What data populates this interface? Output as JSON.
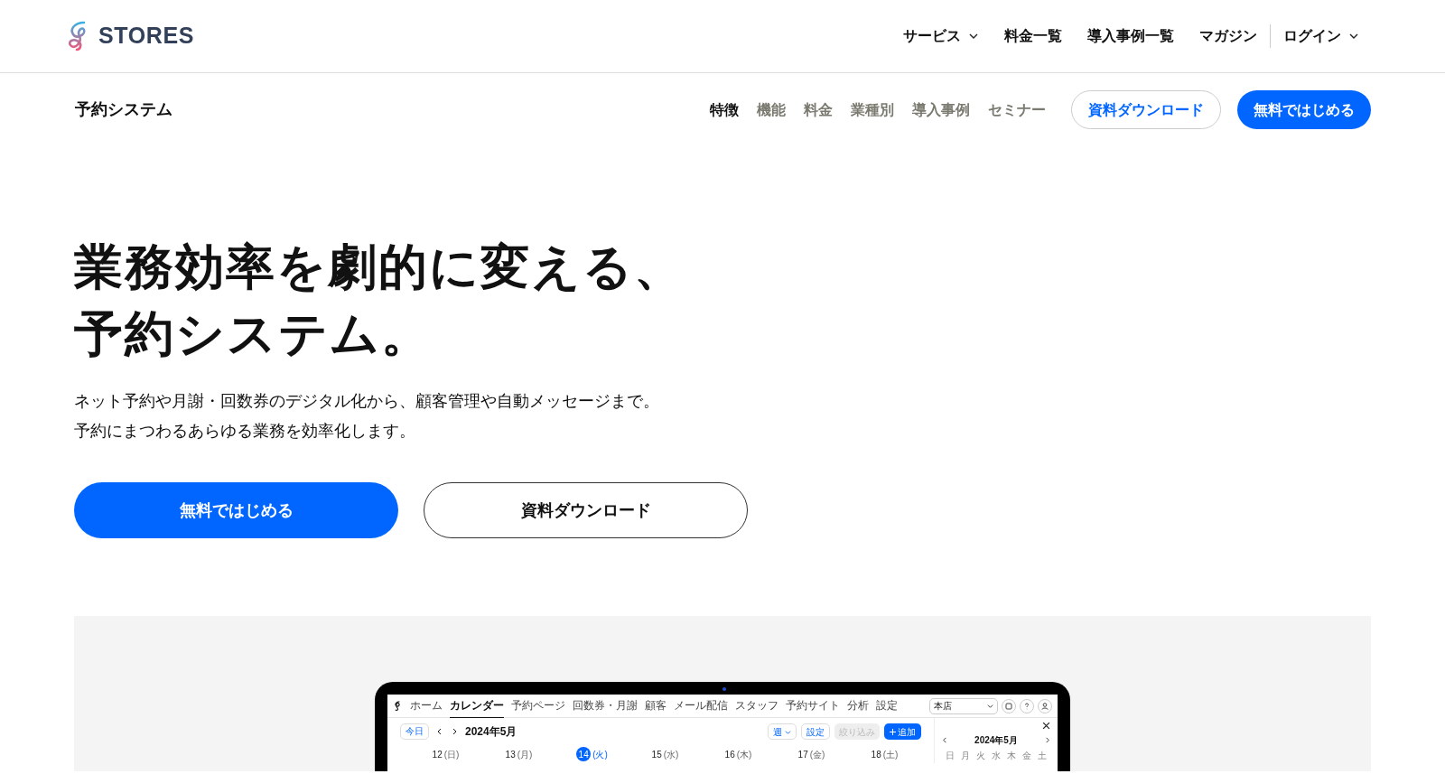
{
  "header": {
    "logo": "STORES",
    "nav": [
      {
        "label": "サービス",
        "dropdown": true
      },
      {
        "label": "料金一覧",
        "dropdown": false
      },
      {
        "label": "導入事例一覧",
        "dropdown": false
      },
      {
        "label": "マガジン",
        "dropdown": false
      }
    ],
    "login": {
      "label": "ログイン",
      "dropdown": true
    }
  },
  "subnav": {
    "title": "予約システム",
    "links": [
      {
        "label": "特徴",
        "selected": true
      },
      {
        "label": "機能",
        "selected": false
      },
      {
        "label": "料金",
        "selected": false
      },
      {
        "label": "業種別",
        "selected": false
      },
      {
        "label": "導入事例",
        "selected": false
      },
      {
        "label": "セミナー",
        "selected": false
      }
    ],
    "buttons": [
      {
        "label": "資料ダウンロード",
        "kind": "outline"
      },
      {
        "label": "無料ではじめる",
        "kind": "primary"
      }
    ]
  },
  "hero": {
    "title_lines": [
      "業務効率を劇的に変える、",
      "予約システム。"
    ],
    "description_lines": [
      "ネット予約や月謝・回数券のデジタル化から、顧客管理や自動メッセージまで。",
      "予約にまつわるあらゆる業務を効率化します。"
    ],
    "buttons": [
      {
        "label": "無料ではじめる",
        "kind": "primary"
      },
      {
        "label": "資料ダウンロード",
        "kind": "outline"
      }
    ]
  },
  "app_preview": {
    "nav": [
      {
        "label": "ホーム",
        "selected": false
      },
      {
        "label": "カレンダー",
        "selected": true
      },
      {
        "label": "予約ページ",
        "selected": false
      },
      {
        "label": "回数券・月謝",
        "selected": false
      },
      {
        "label": "顧客",
        "selected": false
      },
      {
        "label": "メール配信",
        "selected": false
      },
      {
        "label": "スタッフ",
        "selected": false
      },
      {
        "label": "予約サイト",
        "selected": false
      },
      {
        "label": "分析",
        "selected": false
      },
      {
        "label": "設定",
        "selected": false
      }
    ],
    "store_select": "本店",
    "toolbar": {
      "today": "今日",
      "month": "2024年5月",
      "view": "週",
      "buttons": [
        {
          "label": "設定",
          "disabled": false
        },
        {
          "label": "絞り込み",
          "disabled": true
        }
      ],
      "add": "追加"
    },
    "days": [
      {
        "date": "12",
        "weekday": "(日)",
        "selected": false
      },
      {
        "date": "13",
        "weekday": "(月)",
        "selected": false
      },
      {
        "date": "14",
        "weekday": "(火)",
        "selected": true
      },
      {
        "date": "15",
        "weekday": "(水)",
        "selected": false
      },
      {
        "date": "16",
        "weekday": "(木)",
        "selected": false
      },
      {
        "date": "17",
        "weekday": "(金)",
        "selected": false
      },
      {
        "date": "18",
        "weekday": "(土)",
        "selected": false
      }
    ],
    "mini_calendar": {
      "month": "2024年5月",
      "weekdays": [
        "日",
        "月",
        "火",
        "水",
        "木",
        "金",
        "土"
      ]
    }
  }
}
